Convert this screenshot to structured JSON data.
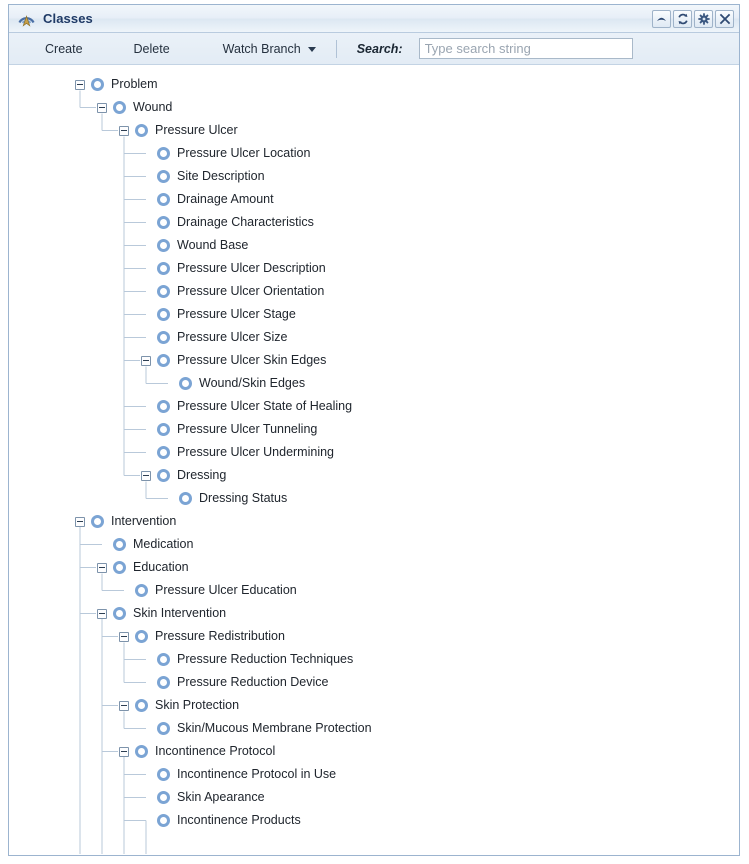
{
  "window": {
    "title": "Classes",
    "logo_icon": "antenna-broadcast-icon",
    "controls": [
      {
        "name": "collapse-button",
        "icon": "triangle-up-icon",
        "label": "Collapse"
      },
      {
        "name": "refresh-button",
        "icon": "refresh-arrows-icon",
        "label": "Refresh"
      },
      {
        "name": "settings-button",
        "icon": "gear-icon",
        "label": "Settings"
      },
      {
        "name": "close-button",
        "icon": "close-x-icon",
        "label": "Close"
      }
    ]
  },
  "toolbar": {
    "create_label": "Create",
    "delete_label": "Delete",
    "watch_branch_label": "Watch Branch",
    "watch_branch_caret": "chevron-down-icon",
    "search_label": "Search:",
    "search_value": "",
    "search_placeholder": "Type search string"
  },
  "tree": {
    "node_icon": "ring-circle-icon",
    "expanded_icon": "minus-box-icon",
    "nodes": [
      {
        "label": "Problem",
        "depth": 0,
        "expandable": true,
        "expanded": true
      },
      {
        "label": "Wound",
        "depth": 1,
        "expandable": true,
        "expanded": true
      },
      {
        "label": "Pressure Ulcer",
        "depth": 2,
        "expandable": true,
        "expanded": true
      },
      {
        "label": "Pressure Ulcer Location",
        "depth": 3,
        "expandable": false,
        "expanded": false
      },
      {
        "label": "Site Description",
        "depth": 3,
        "expandable": false,
        "expanded": false
      },
      {
        "label": "Drainage Amount",
        "depth": 3,
        "expandable": false,
        "expanded": false
      },
      {
        "label": "Drainage Characteristics",
        "depth": 3,
        "expandable": false,
        "expanded": false
      },
      {
        "label": "Wound Base",
        "depth": 3,
        "expandable": false,
        "expanded": false
      },
      {
        "label": "Pressure Ulcer Description",
        "depth": 3,
        "expandable": false,
        "expanded": false
      },
      {
        "label": "Pressure Ulcer Orientation",
        "depth": 3,
        "expandable": false,
        "expanded": false
      },
      {
        "label": "Pressure Ulcer Stage",
        "depth": 3,
        "expandable": false,
        "expanded": false
      },
      {
        "label": "Pressure Ulcer Size",
        "depth": 3,
        "expandable": false,
        "expanded": false
      },
      {
        "label": "Pressure Ulcer Skin Edges",
        "depth": 3,
        "expandable": true,
        "expanded": true
      },
      {
        "label": "Wound/Skin Edges",
        "depth": 4,
        "expandable": false,
        "expanded": false
      },
      {
        "label": "Pressure Ulcer State of Healing",
        "depth": 3,
        "expandable": false,
        "expanded": false
      },
      {
        "label": "Pressure Ulcer Tunneling",
        "depth": 3,
        "expandable": false,
        "expanded": false
      },
      {
        "label": "Pressure Ulcer Undermining",
        "depth": 3,
        "expandable": false,
        "expanded": false
      },
      {
        "label": "Dressing",
        "depth": 3,
        "expandable": true,
        "expanded": true
      },
      {
        "label": "Dressing Status",
        "depth": 4,
        "expandable": false,
        "expanded": false
      },
      {
        "label": "Intervention",
        "depth": 0,
        "expandable": true,
        "expanded": true
      },
      {
        "label": "Medication",
        "depth": 1,
        "expandable": false,
        "expanded": false
      },
      {
        "label": "Education",
        "depth": 1,
        "expandable": true,
        "expanded": true
      },
      {
        "label": "Pressure Ulcer Education",
        "depth": 2,
        "expandable": false,
        "expanded": false
      },
      {
        "label": "Skin Intervention",
        "depth": 1,
        "expandable": true,
        "expanded": true
      },
      {
        "label": "Pressure Redistribution",
        "depth": 2,
        "expandable": true,
        "expanded": true
      },
      {
        "label": "Pressure Reduction Techniques",
        "depth": 3,
        "expandable": false,
        "expanded": false
      },
      {
        "label": "Pressure Reduction Device",
        "depth": 3,
        "expandable": false,
        "expanded": false
      },
      {
        "label": "Skin Protection",
        "depth": 2,
        "expandable": true,
        "expanded": true
      },
      {
        "label": "Skin/Mucous Membrane Protection",
        "depth": 3,
        "expandable": false,
        "expanded": false
      },
      {
        "label": "Incontinence Protocol",
        "depth": 2,
        "expandable": true,
        "expanded": true
      },
      {
        "label": "Incontinence Protocol in Use",
        "depth": 3,
        "expandable": false,
        "expanded": false
      },
      {
        "label": "Skin Apearance",
        "depth": 3,
        "expandable": false,
        "expanded": false
      },
      {
        "label": "Incontinence Products",
        "depth": 3,
        "expandable": false,
        "expanded": false
      }
    ]
  },
  "colors": {
    "title_text": "#1f3a66",
    "node_ring": "#7ba4d4",
    "panel_border": "#9cb4cf",
    "toolbar_bg": "#e6eef6",
    "guide_line": "#b9c9da"
  }
}
